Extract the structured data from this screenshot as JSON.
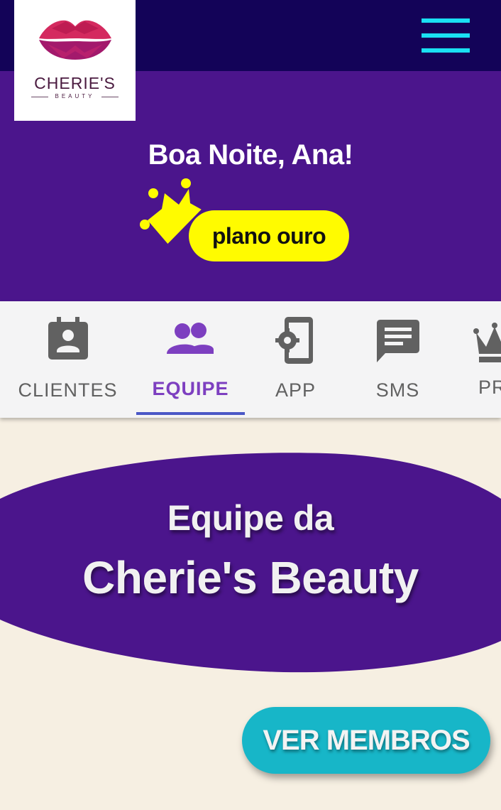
{
  "brand": {
    "name": "CHERIE'S",
    "tagline": "BEAUTY"
  },
  "header": {
    "menu_icon": "hamburger-menu-icon"
  },
  "hero": {
    "greeting": "Boa Noite, Ana!",
    "plan_label": "plano ouro",
    "plan_icon": "crown-icon"
  },
  "tabs": [
    {
      "label": "CLIENTES",
      "icon": "contact-calendar-icon",
      "active": false
    },
    {
      "label": "EQUIPE",
      "icon": "team-icon",
      "active": true
    },
    {
      "label": "APP",
      "icon": "phone-settings-icon",
      "active": false
    },
    {
      "label": "SMS",
      "icon": "message-icon",
      "active": false
    },
    {
      "label": "PR",
      "icon": "crown-icon",
      "active": false
    }
  ],
  "section": {
    "title_line1": "Equipe da",
    "title_line2": "Cherie's Beauty",
    "button_label": "VER MEMBROS"
  },
  "colors": {
    "header_bg": "#130358",
    "hero_bg": "#4b158c",
    "accent_cyan": "#1ae0f3",
    "plan_yellow": "#fffb00",
    "active_tab": "#7d3fc0",
    "page_bg": "#f6efe2",
    "cta_bg": "#17b6c8"
  }
}
